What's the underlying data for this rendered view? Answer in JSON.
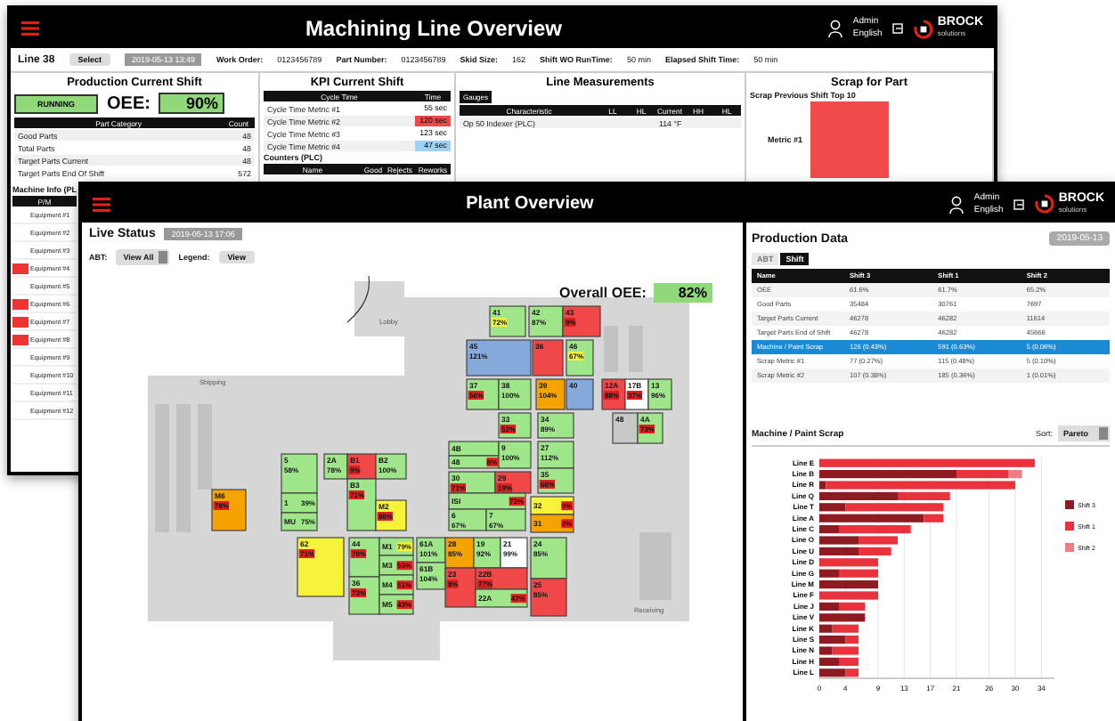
{
  "back_window": {
    "title": "Machining Line Overview",
    "user": {
      "name": "Admin",
      "language": "English"
    },
    "logo": {
      "name": "BROCK",
      "sub": "solutions"
    },
    "info": {
      "line": "Line 38",
      "select_button": "Select",
      "date": "2019-05-13 13:49",
      "fields": [
        {
          "label": "Work Order:",
          "value": "0123456789"
        },
        {
          "label": "Part Number:",
          "value": "0123456789"
        },
        {
          "label": "Skid Size:",
          "value": "162"
        },
        {
          "label": "Shift WO RunTime:",
          "value": "50 min"
        },
        {
          "label": "Elapsed Shift Time:",
          "value": "50 min"
        }
      ]
    },
    "production": {
      "title": "Production Current Shift",
      "status": "RUNNING",
      "oee_label": "OEE:",
      "oee_value": "90%",
      "columns": [
        "Part Category",
        "Count"
      ],
      "rows": [
        [
          "Good Parts",
          "48"
        ],
        [
          "Total Parts",
          "48"
        ],
        [
          "Target Parts Current",
          "48"
        ],
        [
          "Target Parts End Of Shift",
          "572"
        ]
      ]
    },
    "kpi": {
      "title": "KPI Current Shift",
      "columns": [
        "Cycle Time",
        "Time"
      ],
      "rows": [
        {
          "name": "Cycle Time Metric #1",
          "time": "55 sec"
        },
        {
          "name": "Cycle Time Metric #2",
          "time": "120 sec",
          "color": "#f04848"
        },
        {
          "name": "Cycle Time Metric #3",
          "time": "123 sec"
        },
        {
          "name": "Cycle Time Metric #4",
          "time": "47 sec",
          "color": "#9fd0f5"
        }
      ],
      "counters_title": "Counters (PLC)",
      "counters_columns": [
        "Name",
        "Good",
        "Rejects",
        "Reworks"
      ]
    },
    "measurements": {
      "title": "Line Measurements",
      "tabs": [
        {
          "label": "Gauges",
          "selected": true
        }
      ],
      "columns": [
        "Characteristic",
        "LL",
        "HL",
        "Current",
        "HH",
        "HL"
      ],
      "rows": [
        [
          "Op 50 Indexer (PLC)",
          "",
          "",
          "114 °F",
          "",
          ""
        ]
      ]
    },
    "scrap": {
      "title": "Scrap for Part",
      "subtitle": "Scrap Previous Shift Top 10",
      "metric_label": "Metric #1"
    },
    "machine_info": {
      "title": "Machine Info (PL",
      "column": "P/M",
      "rows": [
        {
          "name": "Equipment #1",
          "flag": false
        },
        {
          "name": "Equipment #2",
          "flag": false
        },
        {
          "name": "Equipment #3",
          "flag": false
        },
        {
          "name": "Equipment #4",
          "flag": true
        },
        {
          "name": "Equipment #5",
          "flag": false
        },
        {
          "name": "Equipment #6",
          "flag": true
        },
        {
          "name": "Equipment #7",
          "flag": true
        },
        {
          "name": "Equipment #8",
          "flag": true
        },
        {
          "name": "Equipment #9",
          "flag": false
        },
        {
          "name": "Equipment #10",
          "flag": false
        },
        {
          "name": "Equipment #11",
          "flag": false
        },
        {
          "name": "Equipment #12",
          "flag": false
        }
      ]
    }
  },
  "front_window": {
    "title": "Plant Overview",
    "user": {
      "name": "Admin",
      "language": "English"
    },
    "logo": {
      "name": "BROCK",
      "sub": "solutions"
    },
    "live": {
      "title": "Live Status",
      "date": "2019-05-13 17:06",
      "abt_label": "ABT:",
      "abt_value": "View All",
      "legend_label": "Legend:",
      "view_button": "View",
      "overall_label": "Overall OEE:",
      "overall_value": "82%"
    },
    "map": {
      "labels": [
        "Lobby",
        "Shipping",
        "Receiving"
      ],
      "cells": [
        {
          "label": "41",
          "value": "72%",
          "color": "#9fe58a",
          "kind": "warning"
        },
        {
          "label": "42",
          "value": "87%",
          "color": "#9fe58a",
          "kind": "normal"
        },
        {
          "label": "43",
          "value": "9%",
          "color": "#f04848",
          "kind": "alarm"
        },
        {
          "label": "45",
          "value": "121%",
          "color": "#86a9dc",
          "kind": "normal"
        },
        {
          "label": "36",
          "color": "#f04848",
          "kind": "normal"
        },
        {
          "label": "46",
          "value": "67%",
          "color": "#9fe58a",
          "kind": "warning"
        },
        {
          "label": "37",
          "value": "56%",
          "color": "#9fe58a",
          "kind": "alarm"
        },
        {
          "label": "38",
          "value": "100%",
          "color": "#9fe58a",
          "kind": "normal"
        },
        {
          "label": "39",
          "value": "104%",
          "color": "#f5a300",
          "kind": "normal"
        },
        {
          "label": "40",
          "color": "#86a9dc",
          "kind": "normal"
        },
        {
          "label": "12A",
          "value": "88%",
          "color": "#f04848",
          "kind": "alarm"
        },
        {
          "label": "17B",
          "value": "37%",
          "color": "#ffffff",
          "kind": "alarm"
        },
        {
          "label": "13",
          "value": "96%",
          "color": "#9fe58a",
          "kind": "normal"
        },
        {
          "label": "33",
          "value": "52%",
          "color": "#9fe58a",
          "kind": "alarm"
        },
        {
          "label": "34",
          "value": "89%",
          "color": "#9fe58a",
          "kind": "normal"
        },
        {
          "label": "48",
          "color": "#c8c8c8",
          "kind": "normal"
        },
        {
          "label": "4A",
          "value": "73%",
          "color": "#9fe58a",
          "kind": "alarm"
        },
        {
          "label": "5",
          "value": "58%",
          "color": "#9fe58a",
          "kind": "normal"
        },
        {
          "label": "2A",
          "value": "78%",
          "color": "#9fe58a",
          "kind": "normal"
        },
        {
          "label": "B1",
          "value": "9%",
          "color": "#f04848",
          "kind": "alarm"
        },
        {
          "label": "B2",
          "value": "100%",
          "color": "#9fe58a",
          "kind": "normal"
        },
        {
          "label": "4B",
          "color": "#9fe58a",
          "kind": "normal"
        },
        {
          "label": "48",
          "value": "8%",
          "color": "#9fe58a",
          "kind": "alarm"
        },
        {
          "label": "9",
          "value": "100%",
          "color": "#9fe58a",
          "kind": "normal"
        },
        {
          "label": "27",
          "value": "112%",
          "color": "#9fe58a",
          "kind": "normal"
        },
        {
          "label": "B3",
          "value": "71%",
          "color": "#9fe58a",
          "kind": "alarm"
        },
        {
          "label": "30",
          "value": "71%",
          "color": "#9fe58a",
          "kind": "alarm"
        },
        {
          "label": "29",
          "value": "19%",
          "color": "#f04848",
          "kind": "alarm"
        },
        {
          "label": "35",
          "value": "66%",
          "color": "#9fe58a",
          "kind": "alarm"
        },
        {
          "label": "M6",
          "value": "78%",
          "color": "#f5a300",
          "kind": "alarm"
        },
        {
          "label": "1",
          "value": "39%",
          "color": "#9fe58a",
          "kind": "normal"
        },
        {
          "label": "M2",
          "value": "86%",
          "color": "#f7f23a",
          "kind": "alarm"
        },
        {
          "label": "ISI",
          "value": "72%",
          "color": "#9fe58a",
          "kind": "alarm"
        },
        {
          "label": "32",
          "value": "0%",
          "color": "#f7f23a",
          "kind": "alarm"
        },
        {
          "label": "MU",
          "value": "75%",
          "color": "#9fe58a",
          "kind": "normal"
        },
        {
          "label": "6",
          "value": "67%",
          "color": "#9fe58a",
          "kind": "normal"
        },
        {
          "label": "7",
          "value": "67%",
          "color": "#9fe58a",
          "kind": "normal"
        },
        {
          "label": "31",
          "value": "0%",
          "color": "#f5a300",
          "kind": "alarm"
        },
        {
          "label": "62",
          "value": "71%",
          "color": "#f7f23a",
          "kind": "alarm"
        },
        {
          "label": "44",
          "value": "70%",
          "color": "#9fe58a",
          "kind": "alarm"
        },
        {
          "label": "M1",
          "value": "79%",
          "color": "#9fe58a",
          "kind": "warning"
        },
        {
          "label": "61A",
          "value": "101%",
          "color": "#9fe58a",
          "kind": "normal"
        },
        {
          "label": "28",
          "value": "85%",
          "color": "#f5a300",
          "kind": "normal"
        },
        {
          "label": "19",
          "value": "92%",
          "color": "#9fe58a",
          "kind": "normal"
        },
        {
          "label": "21",
          "value": "99%",
          "color": "#ffffff",
          "kind": "normal"
        },
        {
          "label": "24",
          "value": "85%",
          "color": "#9fe58a",
          "kind": "normal"
        },
        {
          "label": "36",
          "value": "73%",
          "color": "#9fe58a",
          "kind": "alarm"
        },
        {
          "label": "M3",
          "value": "55%",
          "color": "#9fe58a",
          "kind": "alarm"
        },
        {
          "label": "M4",
          "value": "51%",
          "color": "#9fe58a",
          "kind": "alarm"
        },
        {
          "label": "61B",
          "value": "104%",
          "color": "#9fe58a",
          "kind": "normal"
        },
        {
          "label": "23",
          "value": "8%",
          "color": "#f04848",
          "kind": "alarm"
        },
        {
          "label": "22B",
          "value": "77%",
          "color": "#f04848",
          "kind": "alarm"
        },
        {
          "label": "25",
          "value": "85%",
          "color": "#f04848",
          "kind": "normal"
        },
        {
          "label": "M5",
          "value": "43%",
          "color": "#9fe58a",
          "kind": "alarm"
        },
        {
          "label": "22A",
          "value": "47%",
          "color": "#9fe58a",
          "kind": "alarm"
        }
      ]
    },
    "production": {
      "title": "Production Data",
      "date": "2019-05-13",
      "tabs": [
        {
          "label": "ABT",
          "selected": false
        },
        {
          "label": "Shift",
          "selected": true
        }
      ],
      "columns": [
        "Name",
        "Shift 3",
        "Shift 1",
        "Shift 2"
      ],
      "rows": [
        {
          "cells": [
            "OEE",
            "61.6%",
            "61.7%",
            "65.2%"
          ],
          "selected": false
        },
        {
          "cells": [
            "Good Parts",
            "35484",
            "30761",
            "7697"
          ],
          "selected": false
        },
        {
          "cells": [
            "Target Parts Current",
            "46278",
            "46282",
            "11614"
          ],
          "selected": false
        },
        {
          "cells": [
            "Target Parts End of Shift",
            "46278",
            "46282",
            "45666"
          ],
          "selected": false
        },
        {
          "cells": [
            "Machine / Paint Scrap",
            "126 (0.43%)",
            "591 (0.63%)",
            "5 (0.06%)"
          ],
          "selected": true
        },
        {
          "cells": [
            "Scrap Metric #1",
            "77 (0.27%)",
            "115 (0.48%)",
            "5 (0.10%)"
          ],
          "selected": false
        },
        {
          "cells": [
            "Scrap Metric #2",
            "107 (0.38%)",
            "185 (0.36%)",
            "1 (0.01%)"
          ],
          "selected": false
        }
      ]
    },
    "scrap_chart": {
      "title": "Machine / Paint Scrap",
      "sort_label": "Sort:",
      "sort_value": "Pareto",
      "chart_data": {
        "type": "bar",
        "orientation": "horizontal",
        "stacked": true,
        "grid": true,
        "legend": true,
        "categories": [
          "Line E",
          "Line B",
          "Line R",
          "Line Q",
          "Line T",
          "Line A",
          "Line C",
          "Line O",
          "Line U",
          "Line D",
          "Line G",
          "Line M",
          "Line F",
          "Line J",
          "Line V",
          "Line K",
          "Line S",
          "Line N",
          "Line H",
          "Line L"
        ],
        "series": [
          {
            "name": "Shift 3",
            "color": "#8e1b22",
            "values": [
              0,
              21,
              1,
              12,
              4,
              16,
              3,
              6,
              6,
              0,
              3,
              9,
              0,
              3,
              7,
              2,
              4,
              2,
              3,
              4
            ]
          },
          {
            "name": "Shift 1",
            "color": "#e8323c",
            "values": [
              33,
              8,
              29,
              8,
              15,
              3,
              11,
              6,
              5,
              9,
              6,
              0,
              9,
              4,
              0,
              4,
              2,
              4,
              3,
              2
            ]
          },
          {
            "name": "Shift 2",
            "color": "#f07c86",
            "values": [
              0,
              2,
              0,
              0,
              0,
              0,
              0,
              0,
              0,
              0,
              0,
              0,
              0,
              0,
              0,
              0,
              0,
              0,
              0,
              0
            ]
          }
        ],
        "xlim": [
          0,
          36
        ],
        "xticks": [
          {
            "value": 0,
            "label": "0"
          },
          {
            "value": 4,
            "label": "4"
          },
          {
            "value": 9,
            "label": "9"
          },
          {
            "value": 13,
            "label": "13"
          },
          {
            "value": 17,
            "label": "17"
          },
          {
            "value": 21,
            "label": "21"
          },
          {
            "value": 26,
            "label": "26"
          },
          {
            "value": 30,
            "label": "30"
          },
          {
            "value": 34,
            "label": "34"
          }
        ]
      }
    }
  }
}
